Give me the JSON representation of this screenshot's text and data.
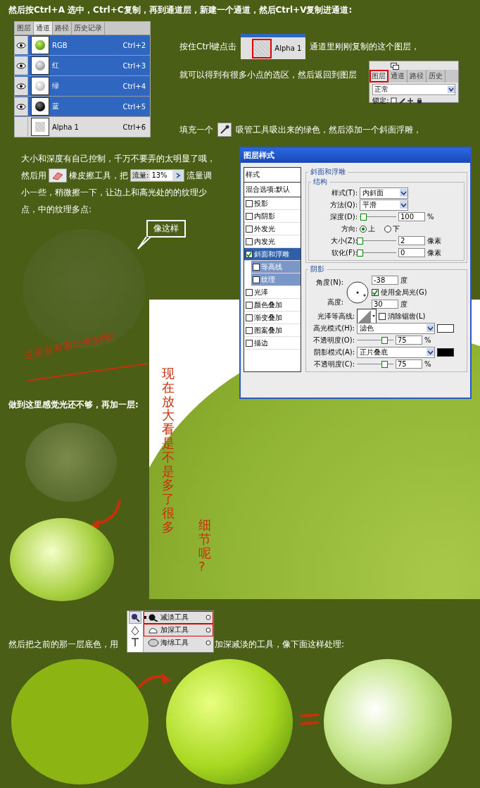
{
  "intro": "然后按Ctrl+A 选中，Ctrl+C复制，再到通道层，新建一个通道，然后Ctrl+V复制进通道:",
  "channels_panel": {
    "tabs": [
      {
        "label": "图层",
        "selected": false
      },
      {
        "label": "通道",
        "selected": true
      },
      {
        "label": "路径",
        "selected": false
      },
      {
        "label": "历史记录",
        "selected": false
      }
    ],
    "rows": [
      {
        "name": "RGB",
        "shortcut": "Ctrl+2",
        "visible": true,
        "selected": true,
        "kind": "rgb"
      },
      {
        "name": "红",
        "shortcut": "Ctrl+3",
        "visible": true,
        "selected": true,
        "kind": "gray"
      },
      {
        "name": "绿",
        "shortcut": "Ctrl+4",
        "visible": true,
        "selected": true,
        "kind": "light"
      },
      {
        "name": "蓝",
        "shortcut": "Ctrl+5",
        "visible": true,
        "selected": true,
        "kind": "dark"
      },
      {
        "name": "Alpha 1",
        "shortcut": "Ctrl+6",
        "visible": false,
        "selected": false,
        "kind": "noise"
      }
    ]
  },
  "ctrl_click": {
    "before": "按住Ctrl键点击",
    "channel": "Alpha 1",
    "after": "通道里刚刚复制的这个图层，"
  },
  "return_step": {
    "text": "就可以得到有很多小点的选区，然后返回到图层",
    "tabs": [
      {
        "label": "图层",
        "selected": true
      },
      {
        "label": "通道",
        "selected": false
      },
      {
        "label": "路径",
        "selected": false
      },
      {
        "label": "历史",
        "selected": false
      }
    ],
    "blend": "正常",
    "lock": "锁定:"
  },
  "fill_step": {
    "before": "填充一个",
    "after": "吸管工具吸出来的绿色，然后添加一个斜面浮雕，"
  },
  "eraser_step": {
    "line1": "大小和深度有自己控制，千万不要弄的太明显了哦，",
    "line2_start": "然后用",
    "line2_mid": "橡皮擦工具，把",
    "flow_label": "流量:",
    "flow_value": "13%",
    "line2_end": "流量调",
    "line3": "小一些，稍微擦一下，让边上和高光处的的纹理少",
    "line4": "点，中的纹理多点:"
  },
  "callout": "像这样",
  "note_left": "这里是有看出来的哦!",
  "note_vertical": [
    "现在放大看是不是多了很多",
    "细节呢?"
  ],
  "light_step": "做到这里感觉光还不够，再加一层:",
  "dialog": {
    "title": "图层样式",
    "styles": [
      {
        "label": "样式",
        "kind": "header"
      },
      {
        "label": "混合选项:默认",
        "kind": "header"
      },
      {
        "label": "投影",
        "kind": "option",
        "checked": false,
        "selected": false
      },
      {
        "label": "内阴影",
        "kind": "option",
        "checked": false,
        "selected": false
      },
      {
        "label": "外发光",
        "kind": "option",
        "checked": false,
        "selected": false
      },
      {
        "label": "内发光",
        "kind": "option",
        "checked": false,
        "selected": false
      },
      {
        "label": "斜面和浮雕",
        "kind": "option",
        "checked": true,
        "selected": true,
        "children": [
          {
            "label": "等高线",
            "checked": false
          },
          {
            "label": "纹理",
            "checked": false
          }
        ]
      },
      {
        "label": "光泽",
        "kind": "option",
        "checked": false,
        "selected": false
      },
      {
        "label": "颜色叠加",
        "kind": "option",
        "checked": false,
        "selected": false
      },
      {
        "label": "渐变叠加",
        "kind": "option",
        "checked": false,
        "selected": false
      },
      {
        "label": "图案叠加",
        "kind": "option",
        "checked": false,
        "selected": false
      },
      {
        "label": "描边",
        "kind": "option",
        "checked": false,
        "selected": false
      }
    ],
    "section": "斜面和浮雕",
    "structure": "结构",
    "style": {
      "label": "样式(T):",
      "value": "内斜面"
    },
    "method": {
      "label": "方法(Q):",
      "value": "平滑"
    },
    "depth": {
      "label": "深度(D):",
      "level": 0.1,
      "value": "100",
      "unit": "%"
    },
    "direction": {
      "label": "方向:",
      "options": [
        {
          "label": "上",
          "selected": true
        },
        {
          "label": "下",
          "selected": false
        }
      ]
    },
    "size": {
      "label": "大小(Z):",
      "level": 0.0,
      "value": "2",
      "unit": "像素"
    },
    "soften": {
      "label": "软化(F):",
      "level": 0.0,
      "value": "0",
      "unit": "像素"
    },
    "shading": "阴影",
    "angle": {
      "label": "角度(N):",
      "value": "-38",
      "unit": "度"
    },
    "global_light": {
      "label": "使用全局光(G)",
      "checked": true
    },
    "altitude": {
      "label": "高度:",
      "value": "30",
      "unit": "度"
    },
    "gloss": {
      "label": "光泽等高线:"
    },
    "antialias": {
      "label": "消除锯齿(L)",
      "checked": false
    },
    "highlight": {
      "label": "高光模式(H):",
      "value": "滤色",
      "color": "#ffffff"
    },
    "highlight_opacity": {
      "label": "不透明度(O):",
      "level": 0.75,
      "value": "75",
      "unit": "%"
    },
    "shadow": {
      "label": "阴影模式(A):",
      "value": "正片叠底",
      "color": "#000000"
    },
    "shadow_opacity": {
      "label": "不透明度(C):",
      "level": 0.75,
      "value": "75",
      "unit": "%"
    }
  },
  "tools_step": {
    "before": "然后把之前的那一层底色，用",
    "items": [
      {
        "label": "减淡工具",
        "kind": "dodge",
        "current": true,
        "highlighted": true
      },
      {
        "label": "加深工具",
        "kind": "burn",
        "current": false,
        "highlighted": true
      },
      {
        "label": "海绵工具",
        "kind": "sponge",
        "current": false,
        "highlighted": false
      }
    ],
    "after": "加深减淡的工具，像下面这样处理:"
  }
}
